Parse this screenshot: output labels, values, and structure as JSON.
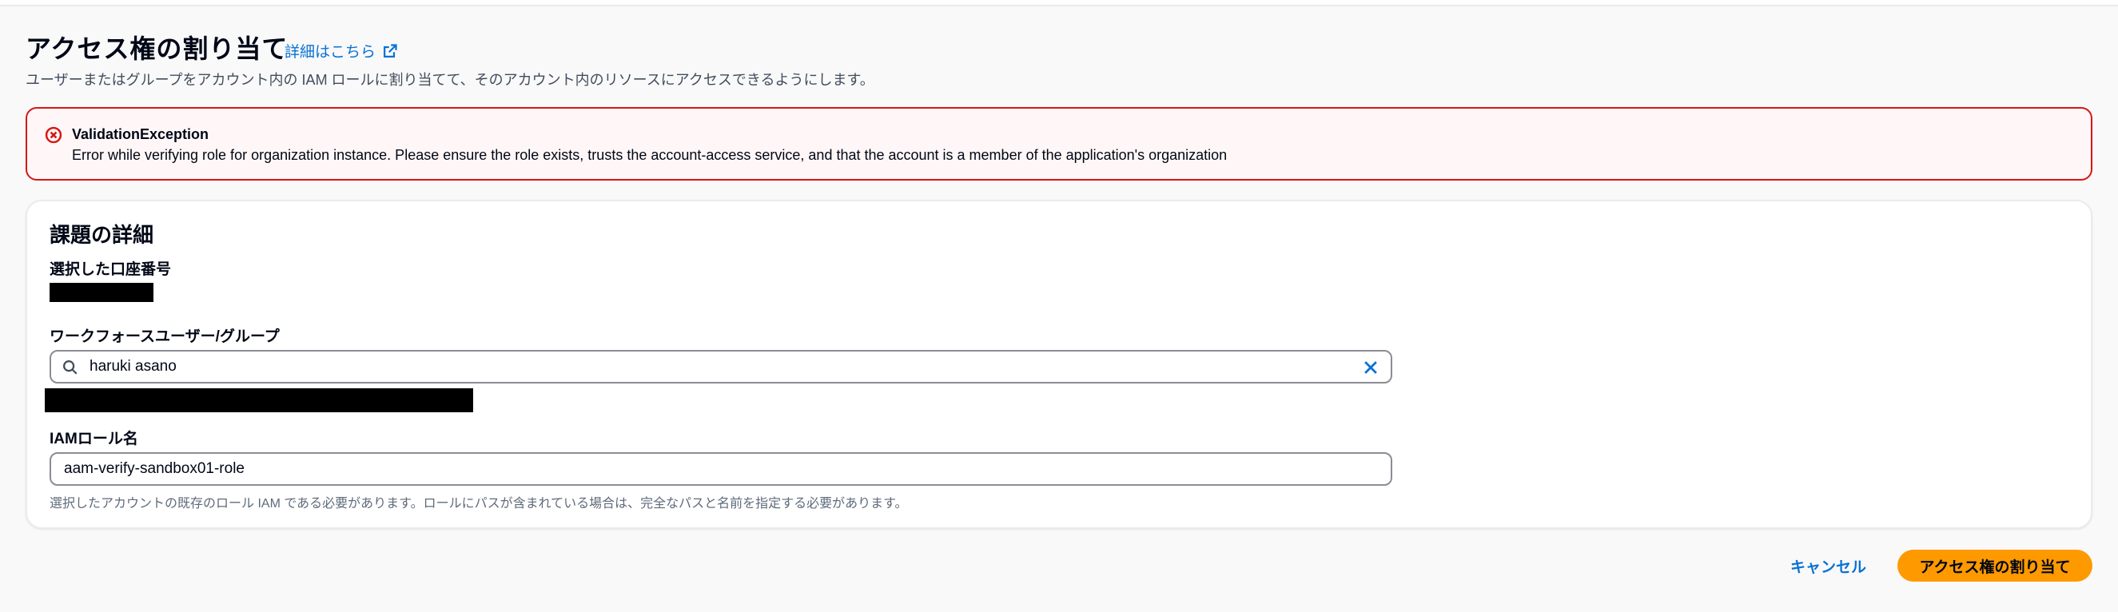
{
  "header": {
    "title": "アクセス権の割り当て",
    "info_link": "詳細はこちら",
    "description": "ユーザーまたはグループをアカウント内の IAM ロールに割り当てて、そのアカウント内のリソースにアクセスできるようにします。"
  },
  "alert": {
    "title": "ValidationException",
    "message": "Error while verifying role for organization instance. Please ensure the role exists, trusts the account-access service, and that the account is a member of the application's organization",
    "icon": "error-circle-icon",
    "color": "#d91515"
  },
  "details": {
    "title": "課題の詳細",
    "account_label": "選択した口座番号",
    "workforce_label": "ワークフォースユーザー/グループ",
    "workforce_value": "haruki asano",
    "role_label": "IAMロール名",
    "role_value": "aam-verify-sandbox01-role",
    "role_constraint": "選択したアカウントの既存のロール IAM である必要があります。ロールにパスが含まれている場合は、完全なパスと名前を指定する必要があります。"
  },
  "actions": {
    "cancel": "キャンセル",
    "submit": "アクセス権の割り当て"
  },
  "colors": {
    "link": "#0972d3",
    "primary": "#ff9900",
    "error": "#d91515"
  }
}
